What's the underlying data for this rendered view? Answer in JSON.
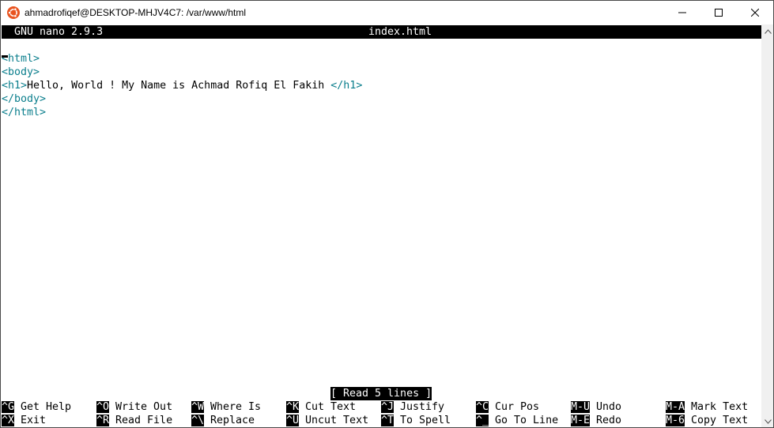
{
  "window": {
    "title": "ahmadrofiqef@DESKTOP-MHJV4C7: /var/www/html",
    "icons": {
      "app": "ubuntu-icon",
      "minimize": "minimize-icon",
      "maximize": "maximize-icon",
      "close": "close-icon"
    }
  },
  "nano": {
    "version_label": "GNU nano 2.9.3",
    "filename": "index.html",
    "status_message": "[ Read 5 lines ]"
  },
  "editor": {
    "lines": [
      {
        "parts": [
          {
            "type": "tag",
            "text": "<html>"
          }
        ]
      },
      {
        "parts": [
          {
            "type": "tag",
            "text": "<body>"
          }
        ]
      },
      {
        "parts": [
          {
            "type": "tag",
            "text": "<h1>"
          },
          {
            "type": "txt",
            "text": "Hello, World ! My Name is Achmad Rofiq El Fakih "
          },
          {
            "type": "tag",
            "text": "</h1>"
          }
        ]
      },
      {
        "parts": [
          {
            "type": "tag",
            "text": "</body>"
          }
        ]
      },
      {
        "parts": [
          {
            "type": "tag",
            "text": "</html>"
          }
        ]
      }
    ]
  },
  "shortcuts": {
    "row1": [
      {
        "key": "^G",
        "label": "Get Help"
      },
      {
        "key": "^O",
        "label": "Write Out"
      },
      {
        "key": "^W",
        "label": "Where Is"
      },
      {
        "key": "^K",
        "label": "Cut Text"
      },
      {
        "key": "^J",
        "label": "Justify"
      },
      {
        "key": "^C",
        "label": "Cur Pos"
      },
      {
        "key": "M-U",
        "label": "Undo"
      },
      {
        "key": "M-A",
        "label": "Mark Text"
      }
    ],
    "row2": [
      {
        "key": "^X",
        "label": "Exit"
      },
      {
        "key": "^R",
        "label": "Read File"
      },
      {
        "key": "^\\",
        "label": "Replace"
      },
      {
        "key": "^U",
        "label": "Uncut Text"
      },
      {
        "key": "^T",
        "label": "To Spell"
      },
      {
        "key": "^_",
        "label": "Go To Line"
      },
      {
        "key": "M-E",
        "label": "Redo"
      },
      {
        "key": "M-6",
        "label": "Copy Text"
      }
    ]
  },
  "colors": {
    "tag": "#0a7e8c",
    "background": "#ffffff",
    "highlight": "#000000"
  }
}
